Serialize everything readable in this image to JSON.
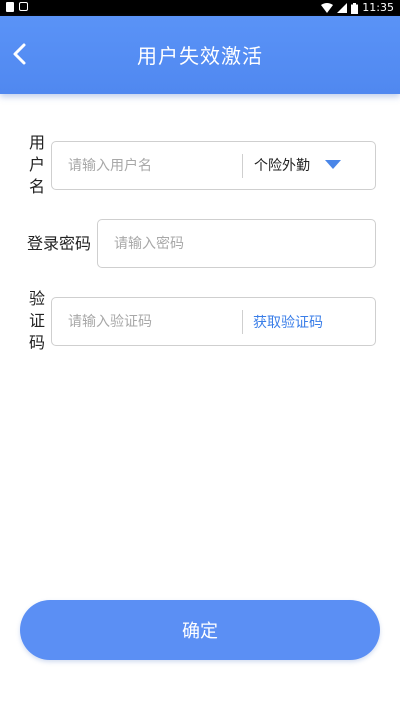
{
  "status_bar": {
    "time": "11:35"
  },
  "header": {
    "title": "用户失效激活"
  },
  "form": {
    "username": {
      "label": "用户名",
      "placeholder": "请输入用户名",
      "selected_type": "个险外勤"
    },
    "password": {
      "label": "登录密码",
      "placeholder": "请输入密码"
    },
    "captcha": {
      "label": "验证码",
      "placeholder": "请输入验证码",
      "get_code_label": "获取验证码"
    }
  },
  "confirm_button": {
    "label": "确定"
  },
  "colors": {
    "primary": "#5b8ff4",
    "link": "#3a7ee8",
    "dropdown": "#4a86e8"
  }
}
